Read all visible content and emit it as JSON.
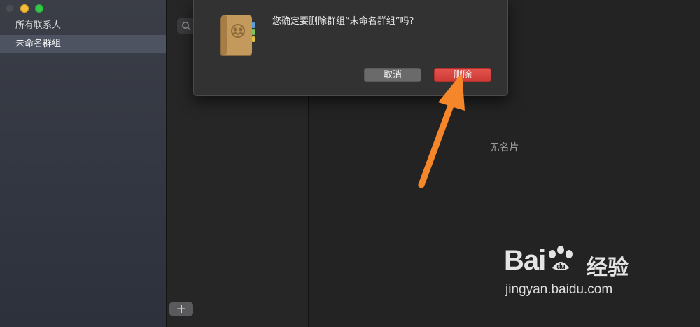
{
  "sidebar": {
    "groups": [
      {
        "label": "所有联系人",
        "selected": false
      },
      {
        "label": "未命名群组",
        "selected": true
      }
    ]
  },
  "list": {
    "add_label": "+"
  },
  "detail": {
    "empty_text": "无名片"
  },
  "dialog": {
    "message": "您确定要删除群组“未命名群组”吗?",
    "cancel_label": "取消",
    "delete_label": "删除",
    "icon": "contacts-book-icon"
  },
  "annotation": {
    "color": "#f5862a"
  },
  "watermark": {
    "brand": "Bai",
    "brand_cn": "经验",
    "url": "jingyan.baidu.com"
  },
  "colors": {
    "accent_delete": "#d9433e",
    "sidebar_selected": "#4d5361"
  }
}
